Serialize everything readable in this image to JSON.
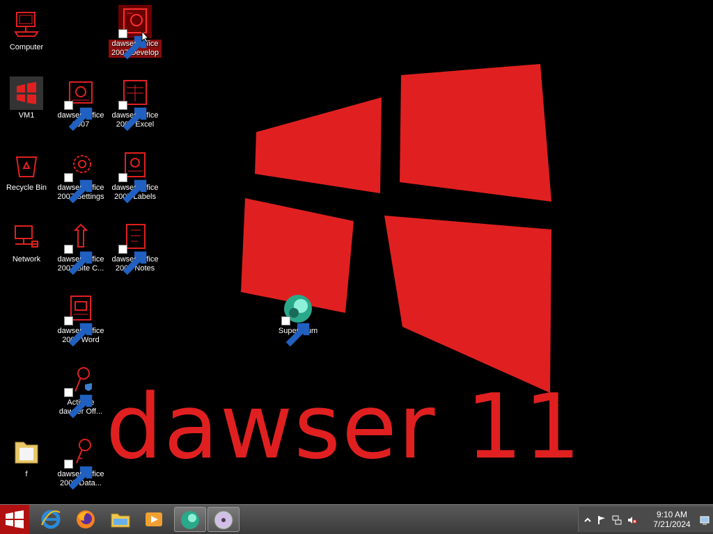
{
  "wallpaper": {
    "text": "dawser 11",
    "accent": "#e02020"
  },
  "desktop": {
    "icons": [
      {
        "label": "Computer",
        "icon": "computer-icon"
      },
      {
        "label": "dawser Office 2007 Develop",
        "icon": "office-develop-icon",
        "selected": true
      },
      {
        "label": "VM1",
        "icon": "vm-icon"
      },
      {
        "label": "dawser Office 2007",
        "icon": "office-icon"
      },
      {
        "label": "dawser Office 2007 Excel",
        "icon": "excel-icon"
      },
      {
        "label": "Recycle Bin",
        "icon": "recycle-bin-icon"
      },
      {
        "label": "dawser Office 2007 Settings",
        "icon": "settings-icon"
      },
      {
        "label": "dawser Office 2007 Labels",
        "icon": "labels-icon"
      },
      {
        "label": "Network",
        "icon": "network-icon"
      },
      {
        "label": "dawser Office 2007 Site C...",
        "icon": "site-icon"
      },
      {
        "label": "dawser Office 2007 Notes",
        "icon": "notes-icon"
      },
      {
        "label": "dawser Office 2007 Word",
        "icon": "word-icon"
      },
      {
        "label": "Supermium",
        "icon": "supermium-icon"
      },
      {
        "label": "Activate dawser Off...",
        "icon": "activate-key-icon"
      },
      {
        "label": "f",
        "icon": "folder-icon"
      },
      {
        "label": "dawser Office 2007 Data...",
        "icon": "data-key-icon"
      }
    ]
  },
  "taskbar": {
    "start_icon": "start-icon",
    "pinned": [
      {
        "name": "internet-explorer-icon"
      },
      {
        "name": "firefox-icon"
      },
      {
        "name": "file-explorer-icon"
      },
      {
        "name": "media-player-icon"
      },
      {
        "name": "supermium-taskbar-icon",
        "active": true
      },
      {
        "name": "dvd-icon"
      }
    ],
    "tray": {
      "icons": [
        "chevron-up-icon",
        "flag-icon",
        "network-tray-icon",
        "volume-muted-icon"
      ],
      "time": "9:10 AM",
      "date": "7/21/2024",
      "show_desktop_icon": "show-desktop-icon"
    }
  }
}
